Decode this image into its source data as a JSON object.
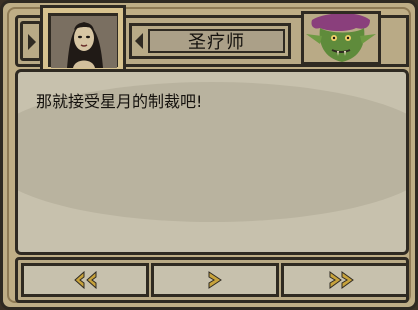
{
  "header": {
    "character_name": "圣疗师"
  },
  "dialogue": {
    "text": "那就接受星月的制裁吧!"
  },
  "portraits": {
    "left": "woman-portrait",
    "right": "goblin-portrait"
  },
  "nav": {
    "prev_icon": "rewind-icon",
    "next_icon": "play-icon",
    "fast_forward_icon": "fast-forward-icon"
  },
  "colors": {
    "frame_bg": "#bfae86",
    "dark_line": "#2f2a22",
    "dialog_bg": "#c7c1ad",
    "arrow_gold": "#c7a23b"
  }
}
